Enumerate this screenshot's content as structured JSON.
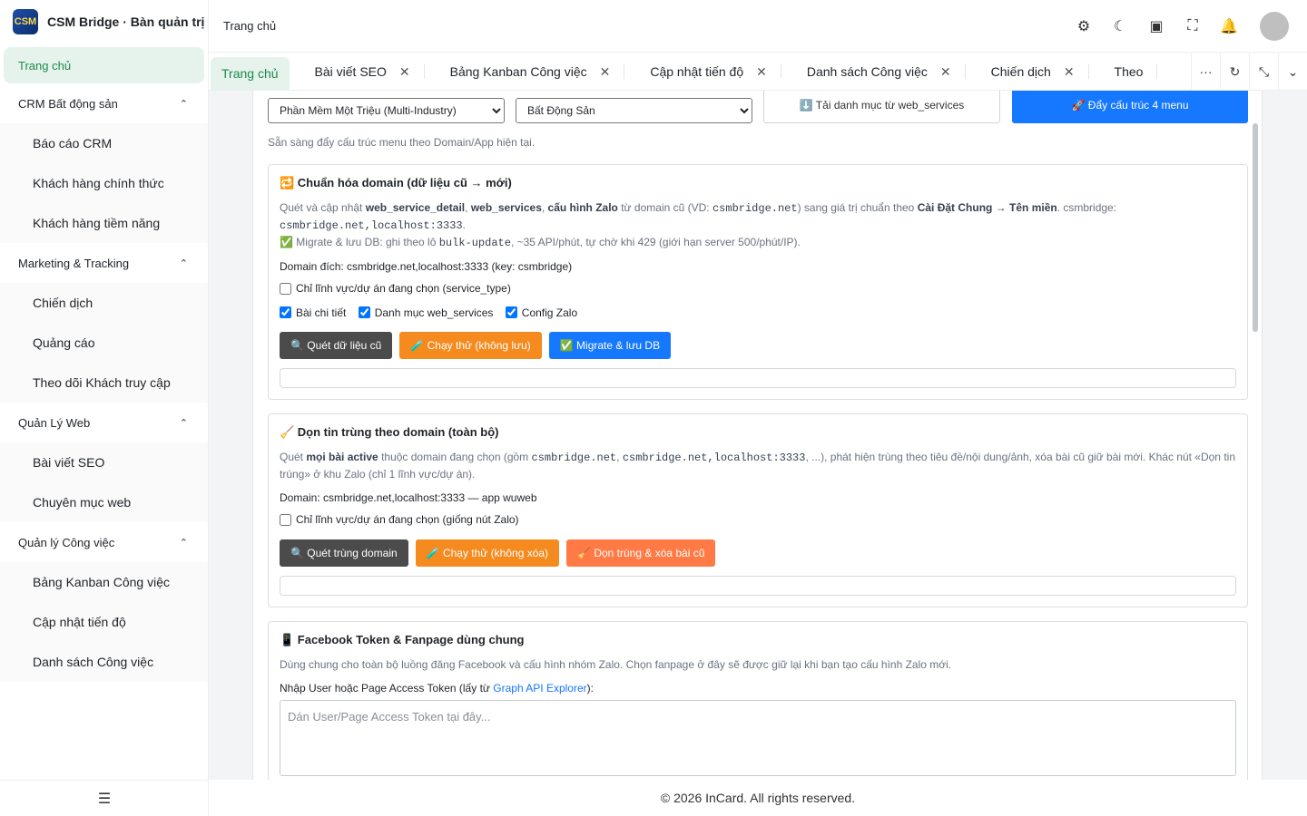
{
  "app": {
    "title": "CSM Bridge · Bàn quản trị",
    "logo_text": "CSM"
  },
  "sidebar": {
    "home": "Trang chủ",
    "groups": [
      {
        "label": "CRM Bất động sản",
        "items": [
          "Báo cáo CRM",
          "Khách hàng chính thức",
          "Khách hàng tiềm năng"
        ]
      },
      {
        "label": "Marketing & Tracking",
        "items": [
          "Chiến dịch",
          "Quảng cáo",
          "Theo dõi Khách truy cập"
        ]
      },
      {
        "label": "Quản Lý Web",
        "items": [
          "Bài viết SEO",
          "Chuyên mục web"
        ]
      },
      {
        "label": "Quản lý Công việc",
        "items": [
          "Bảng Kanban Công việc",
          "Cập nhật tiến độ",
          "Danh sách Công việc"
        ]
      }
    ]
  },
  "header": {
    "breadcrumb": "Trang chủ"
  },
  "tabs": [
    "Trang chủ",
    "Bài viết SEO",
    "Bảng Kanban Công việc",
    "Cập nhật tiến độ",
    "Danh sách Công việc",
    "Chiến dịch",
    "Theo"
  ],
  "toolbar": {
    "app_select": "Phần Mềm Một Triệu (Multi-Industry)",
    "domain_select": "Bất Động Sản",
    "load_button": "⬇️ Tải danh mục từ web_services",
    "push_button": "🚀 Đẩy cấu trúc 4 menu",
    "ready_note": "Sẵn sàng đẩy cấu trúc menu theo Domain/App hiện tại."
  },
  "normalize": {
    "title": "🔁 Chuẩn hóa domain (dữ liệu cũ → mới)",
    "desc_1": "Quét và cập nhật ",
    "b1": "web_service_detail",
    "sep1": ", ",
    "b2": "web_services",
    "sep2": ", ",
    "b3": "cấu hình Zalo",
    "desc_2": " từ domain cũ (VD: ",
    "m1": "csmbridge.net",
    "desc_3": ") sang giá trị chuẩn theo ",
    "b4": "Cài Đặt Chung → Tên miền",
    "desc_4": ". csmbridge: ",
    "m2": "csmbridge.net,localhost:3333",
    "desc_5": ".",
    "migrate_note_1": "✅ Migrate & lưu DB: ghi theo lô ",
    "m3": "bulk-update",
    "migrate_note_2": ", ~35 API/phút, tự chờ khi 429 (giới hạn server 500/phút/IP).",
    "target": "Domain đích: csmbridge.net,localhost:3333 (key: csmbridge)",
    "only_current": "Chỉ lĩnh vực/dự án đang chọn (service_type)",
    "opt_detail": "Bài chi tiết",
    "opt_services": "Danh mục web_services",
    "opt_zalo": "Config Zalo",
    "scan_button": "🔍 Quét dữ liệu cũ",
    "dry_button": "🧪 Chạy thử (không lưu)",
    "migrate_button": "✅ Migrate & lưu DB"
  },
  "dedupe": {
    "title": "🧹 Dọn tin trùng theo domain (toàn bộ)",
    "d1": "Quét ",
    "b1": "mọi bài active",
    "d2": " thuộc domain đang chọn (gồm ",
    "m1": "csmbridge.net",
    "d3": ", ",
    "m2": "csmbridge.net,localhost:3333",
    "d4": ", ...), phát hiện trùng theo tiêu đề/nội dung/ảnh, xóa bài cũ giữ bài mới. Khác nút «Dọn tin trùng» ở khu Zalo (chỉ 1 lĩnh vực/dự án).",
    "domain_line": "Domain: csmbridge.net,localhost:3333 — app wuweb",
    "only_current": "Chỉ lĩnh vực/dự án đang chọn (giống nút Zalo)",
    "scan_button": "🔍 Quét trùng domain",
    "dry_button": "🧪 Chạy thử (không xóa)",
    "clean_button": "🧹 Dọn trùng & xóa bài cũ"
  },
  "facebook": {
    "title": "📱 Facebook Token & Fanpage dùng chung",
    "desc": "Dùng chung cho toàn bộ luồng đăng Facebook và cấu hình nhóm Zalo. Chọn fanpage ở đây sẽ được giữ lại khi bạn tạo cấu hình Zalo mới.",
    "label_1": "Nhập User hoặc Page Access Token (lấy từ ",
    "link": "Graph API Explorer",
    "label_2": "):",
    "placeholder": "Dán User/Page Access Token tại đây..."
  },
  "footer": {
    "text": "© 2026 InCard. All rights reserved."
  },
  "colors": {
    "accent_green": "#1a8a4a",
    "primary_blue": "#1677ff",
    "orange": "#f58a1f"
  }
}
